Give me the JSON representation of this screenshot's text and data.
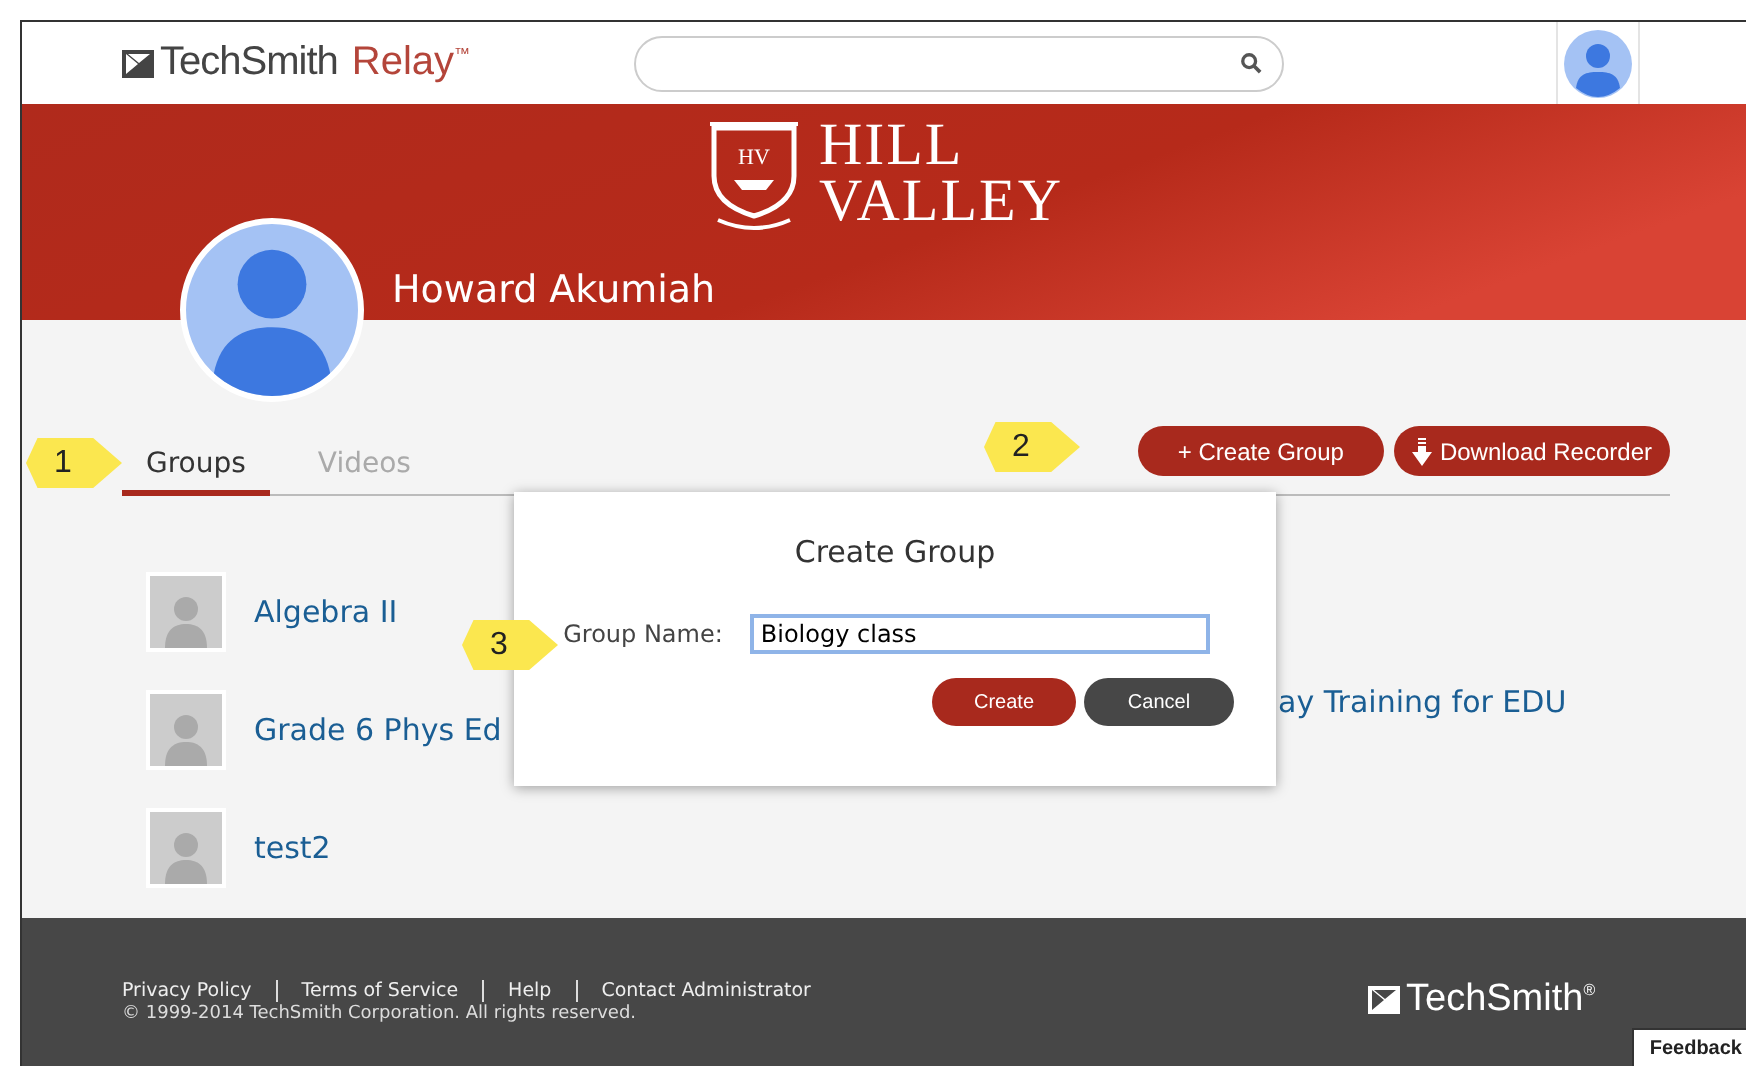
{
  "header": {
    "brand": "TechSmith",
    "product": "Relay",
    "trademark": "™"
  },
  "banner": {
    "school_line_1": "HILL",
    "school_line_2": "VALLEY",
    "crest_initials": "HV",
    "user_name": "Howard Akumiah"
  },
  "tabs": [
    {
      "label": "Groups",
      "selected": true
    },
    {
      "label": "Videos",
      "selected": false
    }
  ],
  "actions": [
    {
      "label": "+ Create Group",
      "kind": "plain"
    },
    {
      "label": "Download Recorder",
      "kind": "download"
    }
  ],
  "groups_left": [
    {
      "name": "Algebra II"
    },
    {
      "name": "Grade 6 Phys Ed"
    },
    {
      "name": "test2"
    }
  ],
  "groups_right": [
    {
      "name": "ay Training for EDU"
    }
  ],
  "dialog": {
    "title": "Create Group",
    "field_label": "Group Name:",
    "field_value": "Biology class",
    "buttons": [
      {
        "label": "Create",
        "kind": "primary"
      },
      {
        "label": "Cancel",
        "kind": "secondary"
      }
    ]
  },
  "callouts": [
    "1",
    "2",
    "3"
  ],
  "footer": {
    "links": [
      "Privacy Policy",
      "Terms of Service",
      "Help",
      "Contact Administrator"
    ],
    "copyright": "© 1999-2014 TechSmith Corporation. All rights reserved.",
    "brand": "TechSmith",
    "registered": "®",
    "feedback": "Feedback"
  }
}
